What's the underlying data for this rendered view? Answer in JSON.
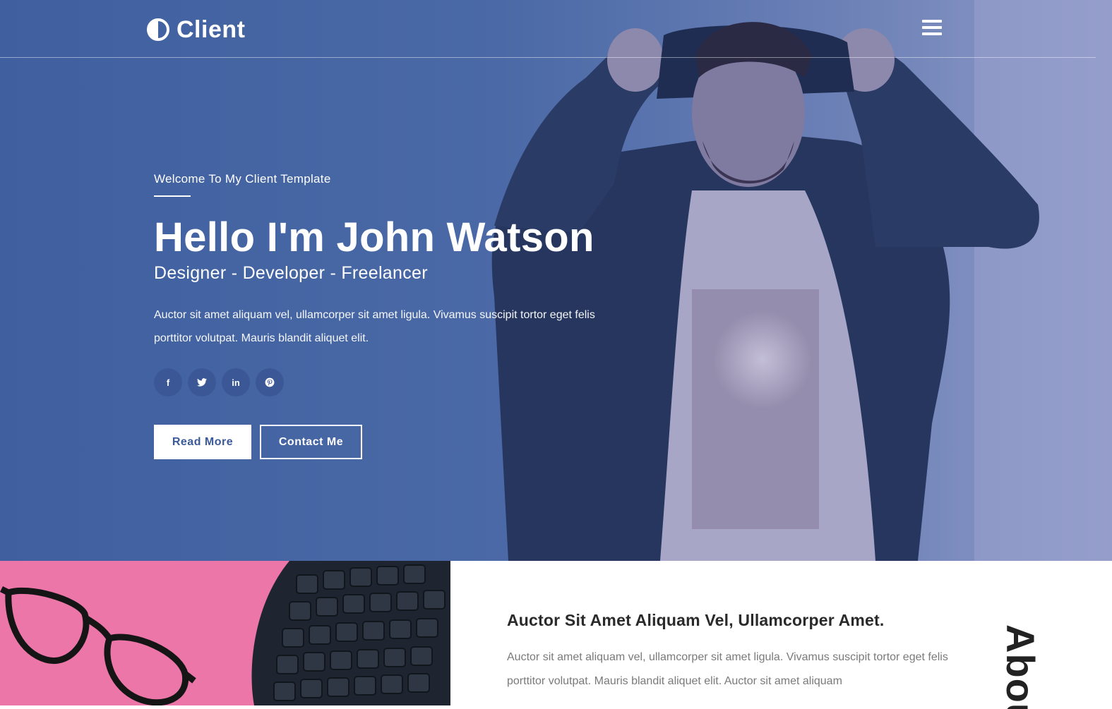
{
  "header": {
    "logo_text": "Client",
    "logo_icon": "half-circle-icon",
    "menu_icon": "hamburger-menu-icon"
  },
  "hero": {
    "welcome": "Welcome To My Client Template",
    "headline": "Hello I'm John Watson",
    "subline": "Designer - Developer - Freelancer",
    "intro": "Auctor sit amet aliquam vel, ullamcorper sit amet ligula. Vivamus suscipit tortor eget felis porttitor volutpat. Mauris blandit aliquet elit.",
    "socials": [
      {
        "icon": "facebook-icon",
        "glyph": "f"
      },
      {
        "icon": "twitter-icon",
        "glyph": "t"
      },
      {
        "icon": "linkedin-icon",
        "glyph": "in"
      },
      {
        "icon": "pinterest-icon",
        "glyph": "p"
      }
    ],
    "read_more_label": "Read More",
    "contact_label": "Contact Me"
  },
  "about": {
    "heading": "Auctor Sit Amet Aliquam Vel, Ullamcorper Amet.",
    "body": "Auctor sit amet aliquam vel, ullamcorper sit amet ligula. Vivamus suscipit tortor eget felis porttitor volutpat. Mauris blandit aliquet elit. Auctor sit amet aliquam",
    "vertical_title": "About"
  },
  "colors": {
    "hero_blue": "#4a69a6",
    "social_bg": "#3b5796",
    "pink": "#ec76a8"
  }
}
